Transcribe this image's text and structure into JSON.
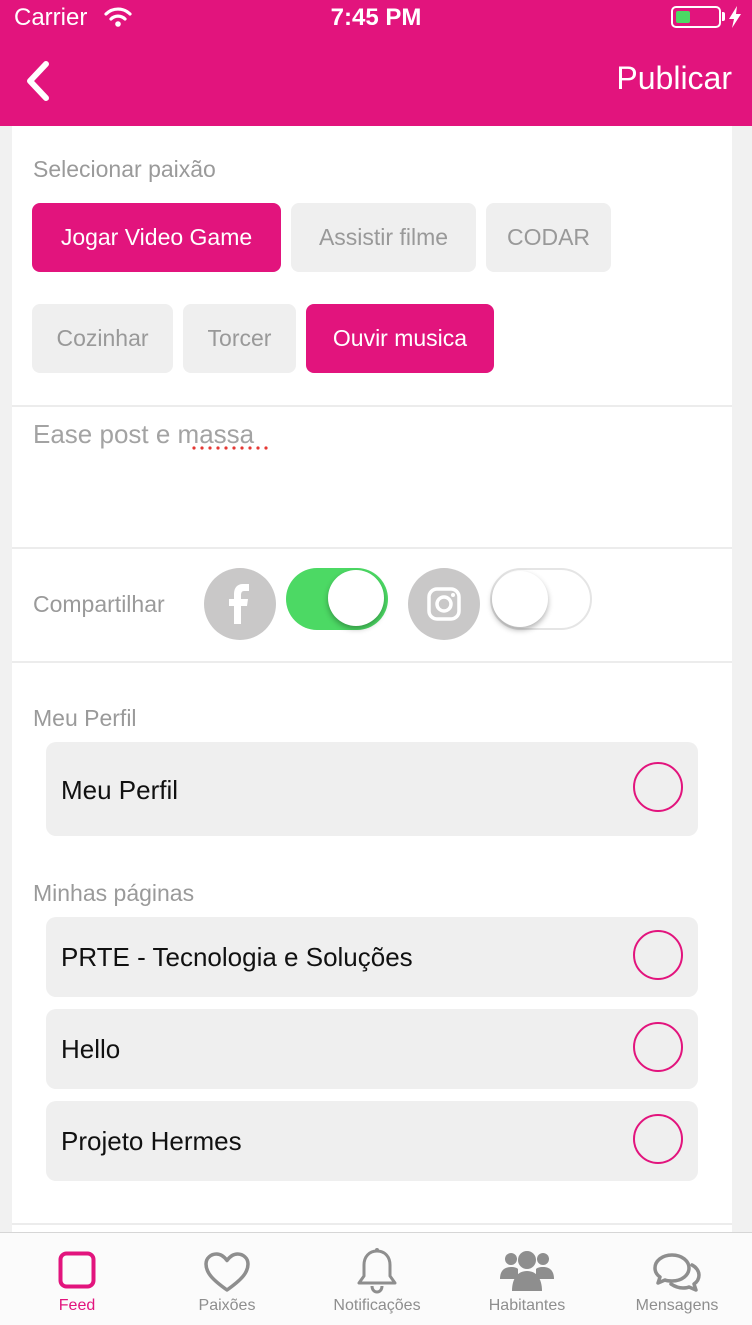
{
  "status_bar": {
    "carrier": "Carrier",
    "time": "7:45 PM",
    "battery_level": 0.35
  },
  "header": {
    "back_icon": "chevron-left-icon",
    "publish_label": "Publicar"
  },
  "passions": {
    "label": "Selecionar paixão",
    "chips": [
      {
        "label": "Jogar Video Game",
        "selected": true
      },
      {
        "label": "Assistir filme",
        "selected": false
      },
      {
        "label": "CODAR",
        "selected": false
      },
      {
        "label": "Cozinhar",
        "selected": false
      },
      {
        "label": "Torcer",
        "selected": false
      },
      {
        "label": "Ouvir musica",
        "selected": true
      }
    ]
  },
  "post": {
    "placeholder": "Ease post e massa"
  },
  "share": {
    "label": "Compartilhar",
    "facebook": {
      "icon": "facebook-icon",
      "enabled": true
    },
    "instagram": {
      "icon": "instagram-icon",
      "enabled": false
    }
  },
  "profile": {
    "label": "Meu Perfil",
    "items": [
      {
        "label": "Meu Perfil",
        "selected": false
      }
    ]
  },
  "pages": {
    "label": "Minhas páginas",
    "items": [
      {
        "label": "PRTE - Tecnologia e Soluções",
        "selected": false
      },
      {
        "label": "Hello",
        "selected": false
      },
      {
        "label": "Projeto Hermes",
        "selected": false
      }
    ]
  },
  "tabs": [
    {
      "label": "Feed",
      "icon": "feed-icon",
      "active": true
    },
    {
      "label": "Paixões",
      "icon": "heart-icon",
      "active": false
    },
    {
      "label": "Notificações",
      "icon": "bell-icon",
      "active": false
    },
    {
      "label": "Habitantes",
      "icon": "people-icon",
      "active": false
    },
    {
      "label": "Mensagens",
      "icon": "chat-bubbles-icon",
      "active": false
    }
  ],
  "colors": {
    "accent": "#e2147d",
    "toggle_on": "#4cd964",
    "chip_bg": "#efefef"
  }
}
